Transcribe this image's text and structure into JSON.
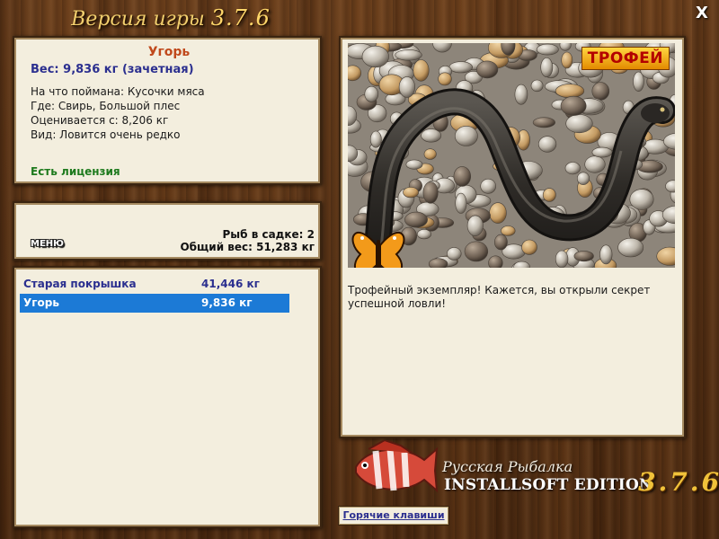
{
  "header": {
    "title_prefix": "Версия игры",
    "title_version": "3.7.6",
    "close_label": "X"
  },
  "fish_info": {
    "name": "Угорь",
    "weight": "Вес: 9,836 кг (зачетная)",
    "bait": "На что поймана: Кусочки мяса",
    "location": "Где: Свирь, Большой плес",
    "rated_from": "Оценивается с: 8,206 кг",
    "kind": "Вид: Ловится очень редко",
    "license": "Есть лицензия"
  },
  "keeper": {
    "menu_label": "МЕНЮ",
    "fish_count": "Рыб в садке: 2",
    "total_weight": "Общий вес: 51,283 кг"
  },
  "catch_list": [
    {
      "name": "Старая покрышка",
      "weight": "41,446 кг",
      "selected": false
    },
    {
      "name": "Угорь",
      "weight": "9,836 кг",
      "selected": true
    }
  ],
  "trophy": {
    "badge": "ТРОФЕЙ",
    "comment": "Трофейный экземпляр! Кажется, вы открыли секрет успешной ловли!"
  },
  "logo": {
    "line1": "Русская Рыбалка",
    "line2": "INSTALLSOFT EDITION",
    "version": "3.7.6"
  },
  "hotkeys_label": "Горячие клавиши",
  "colors": {
    "fish_name": "#c0491c",
    "weight_text": "#2b2f8f",
    "license_text": "#1d7a1d",
    "selection": "#1c7ad6",
    "trophy_text": "#b30000"
  }
}
